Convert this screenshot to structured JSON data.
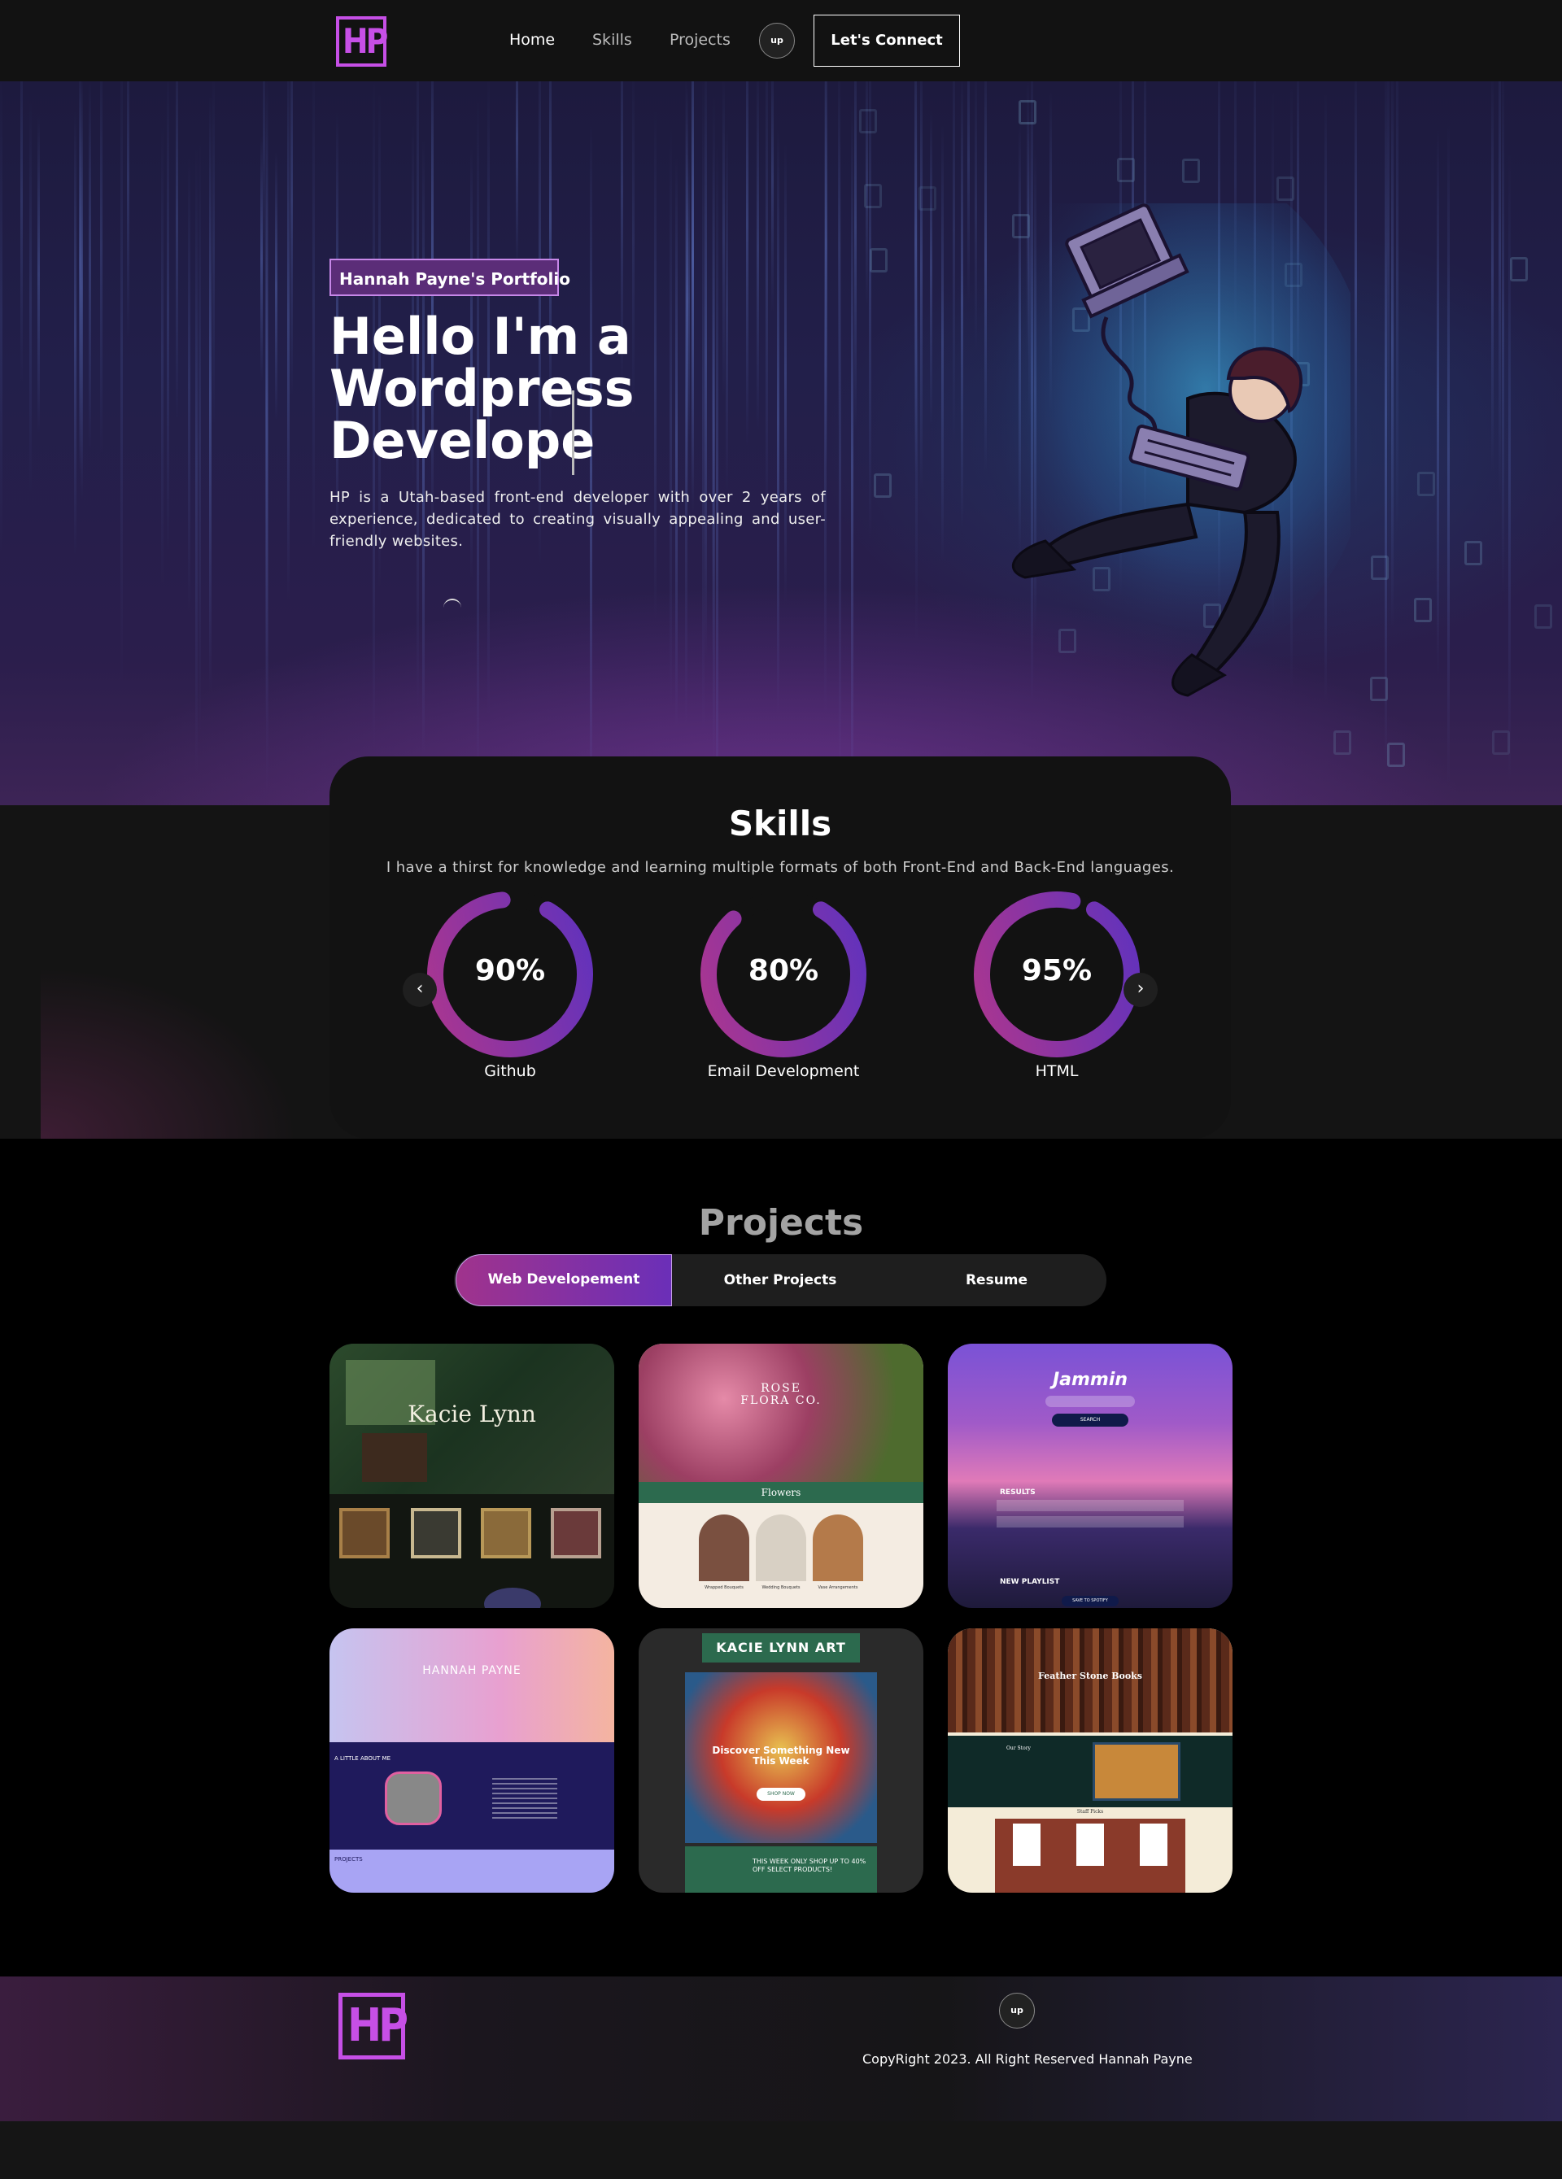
{
  "nav": {
    "logo": "HP",
    "links": [
      "Home",
      "Skills",
      "Projects"
    ],
    "up_label": "up",
    "connect_label": "Let's Connect"
  },
  "hero": {
    "badge": "Hannah Payne's Portfolio",
    "title_lines": [
      "Hello I'm a",
      "Wordpress",
      "Develope"
    ],
    "description": "HP is a Utah-based front-end developer with over 2 years of experience, dedicated to creating visually appealing and user-friendly websites."
  },
  "skills": {
    "title": "Skills",
    "subtitle": "I have a thirst for knowledge and learning multiple formats of both Front-End and Back-End languages.",
    "items": [
      {
        "value": "90%",
        "label": "Github",
        "percent": 90
      },
      {
        "value": "80%",
        "label": "Email Development",
        "percent": 80
      },
      {
        "value": "95%",
        "label": "HTML",
        "percent": 95
      }
    ],
    "prev_icon": "‹",
    "next_icon": "›"
  },
  "projects": {
    "title": "Projects",
    "tabs": [
      "Web Developement",
      "Other Projects",
      "Resume"
    ],
    "thumbs": [
      {
        "title": "Kacie Lynn"
      },
      {
        "title": "ROSE FLORA CO.",
        "section": "Flowers",
        "items": [
          "Wrapped Bouquets",
          "Wedding Bouquets",
          "Vase Arrangements"
        ]
      },
      {
        "title": "Jammin",
        "search": "SEARCH",
        "results": "RESULTS",
        "playlist": "NEW PLAYLIST",
        "save": "SAVE TO SPOTIFY"
      },
      {
        "title": "HANNAH PAYNE",
        "about": "A LITTLE ABOUT ME",
        "projects": "PROJECTS"
      },
      {
        "title": "KACIE LYNN ART",
        "headline": "Discover Something New This Week",
        "shop": "SHOP NOW",
        "promo": "THIS WEEK ONLY SHOP UP TO 40% OFF SELECT PRODUCTS!"
      },
      {
        "title": "Feather Stone Books",
        "story": "Our Story",
        "picks": "Staff Picks"
      }
    ]
  },
  "footer": {
    "logo": "HP",
    "up_label": "up",
    "copyright": "CopyRight 2023. All Right Reserved Hannah Payne"
  },
  "colors": {
    "accent": "#c64fe6",
    "ring_start": "#b0368c",
    "ring_end": "#5b32c0"
  }
}
